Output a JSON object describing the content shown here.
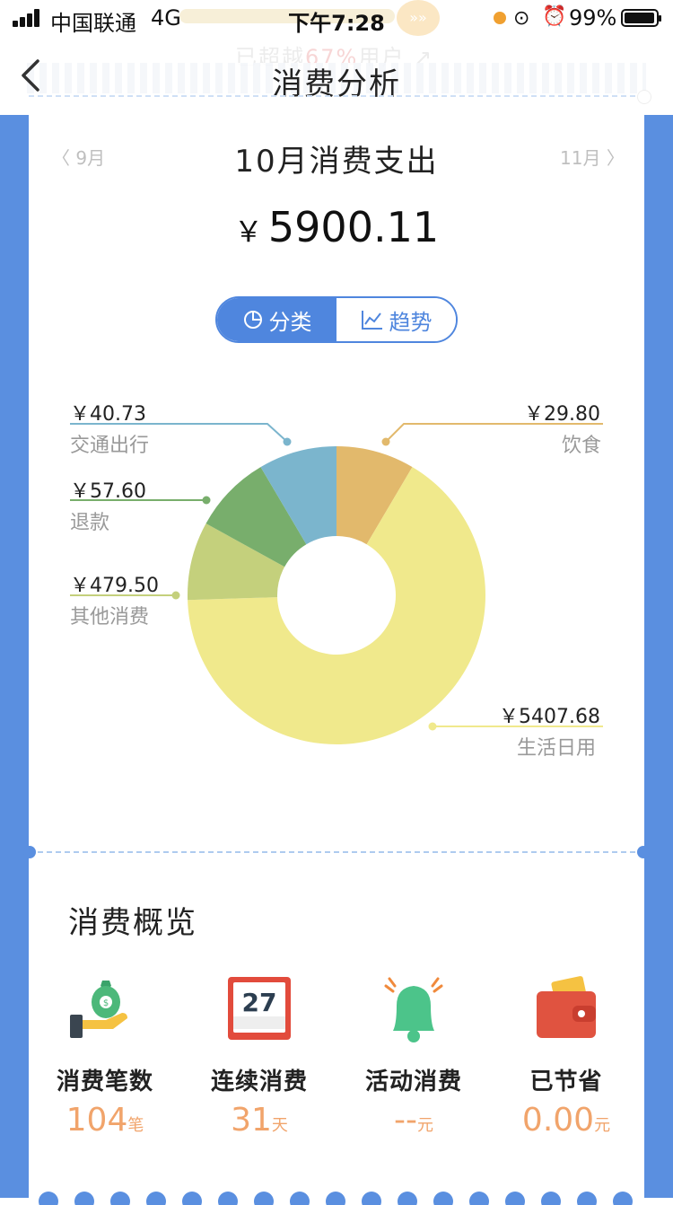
{
  "status_bar": {
    "carrier": "中国联通",
    "network": "4G",
    "time": "下午7:28",
    "battery": "99%"
  },
  "ghost_banner": {
    "prefix": "已超越",
    "highlight": "67%",
    "suffix": "用户"
  },
  "nav": {
    "title": "消费分析"
  },
  "month": {
    "prev": "9月",
    "title": "10月消费支出",
    "next": "11月"
  },
  "total": {
    "currency": "￥",
    "amount": "5900.11"
  },
  "toggle": {
    "category": "分类",
    "trend": "趋势"
  },
  "chart_data": {
    "type": "pie",
    "donut": true,
    "slices": [
      {
        "name": "饮食",
        "value": 29.8,
        "label": "￥29.80",
        "color": "#e2b96c"
      },
      {
        "name": "生活日用",
        "value": 5407.68,
        "label": "￥5407.68",
        "color": "#f0e98c"
      },
      {
        "name": "其他消费",
        "value": 479.5,
        "label": "￥479.50",
        "color": "#c4d07c"
      },
      {
        "name": "退款",
        "value": 57.6,
        "label": "￥57.60",
        "color": "#78ae6c"
      },
      {
        "name": "交通出行",
        "value": 40.73,
        "label": "￥40.73",
        "color": "#7bb5cd"
      }
    ]
  },
  "overview": {
    "title": "消费概览",
    "items": [
      {
        "label": "消费笔数",
        "value": "104",
        "unit": "笔",
        "icon": "money-bag-hand-icon"
      },
      {
        "label": "连续消费",
        "value": "31",
        "unit": "天",
        "icon": "calendar-icon",
        "badge": "27"
      },
      {
        "label": "活动消费",
        "value": "--",
        "unit": "元",
        "icon": "bell-icon"
      },
      {
        "label": "已节省",
        "value": "0.00",
        "unit": "元",
        "icon": "wallet-icon"
      }
    ]
  }
}
